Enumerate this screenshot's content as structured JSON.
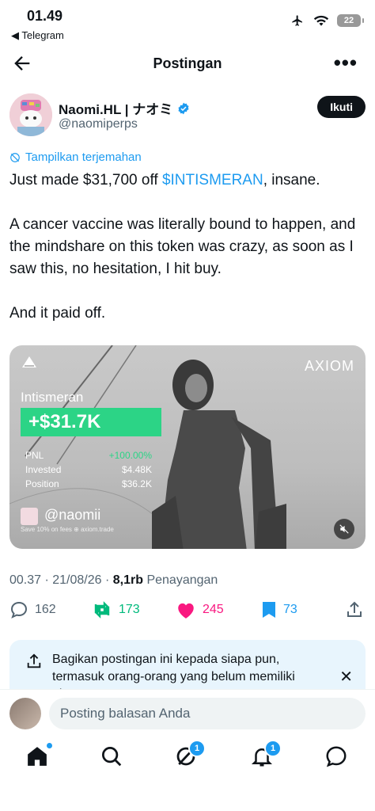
{
  "status": {
    "time": "01.49",
    "back_app": "◀ Telegram",
    "battery": "22"
  },
  "header": {
    "title": "Postingan"
  },
  "author": {
    "name": "Naomi.HL | ナオミ",
    "handle": "@naomiperps",
    "follow_label": "Ikuti"
  },
  "translate_label": "Tampilkan terjemahan",
  "tweet": {
    "line1_pre": "Just made $31,700 off ",
    "cashtag": "$INTISMERAN",
    "line1_post": ", insane.",
    "para2": "A cancer vaccine was literally bound to happen, and the mindshare on this token was crazy, as soon as I saw this, no hesitation, I hit buy.",
    "para3": "And it paid off."
  },
  "media": {
    "brand": "AXIOM",
    "token_name": "Intismeran",
    "pnl_value": "+$31.7K",
    "stats": [
      {
        "label": "PNL",
        "value": "+100.00%"
      },
      {
        "label": "Invested",
        "value": "$4.48K"
      },
      {
        "label": "Position",
        "value": "$36.2K"
      }
    ],
    "ref_handle": "@naomii",
    "ref_footer": "Save 10% on fees  ⊕ axiom.trade"
  },
  "meta": {
    "time_date": "00.37 · 21/08/26 · ",
    "views_count": "8,1rb",
    "views_label": " Penayangan"
  },
  "actions": {
    "replies": "162",
    "reposts": "173",
    "likes": "245",
    "bookmarks": "73"
  },
  "colors": {
    "accent": "#1d9bf0",
    "repost": "#00ba7c",
    "like": "#f91880",
    "pnl_green": "#2cd486"
  },
  "share_banner": {
    "text": "Bagikan postingan ini kepada siapa pun, termasuk orang-orang yang belum memiliki akun X."
  },
  "reply": {
    "placeholder": "Posting balasan Anda"
  },
  "tabs": {
    "grok_badge": "1",
    "notifications_badge": "1"
  }
}
